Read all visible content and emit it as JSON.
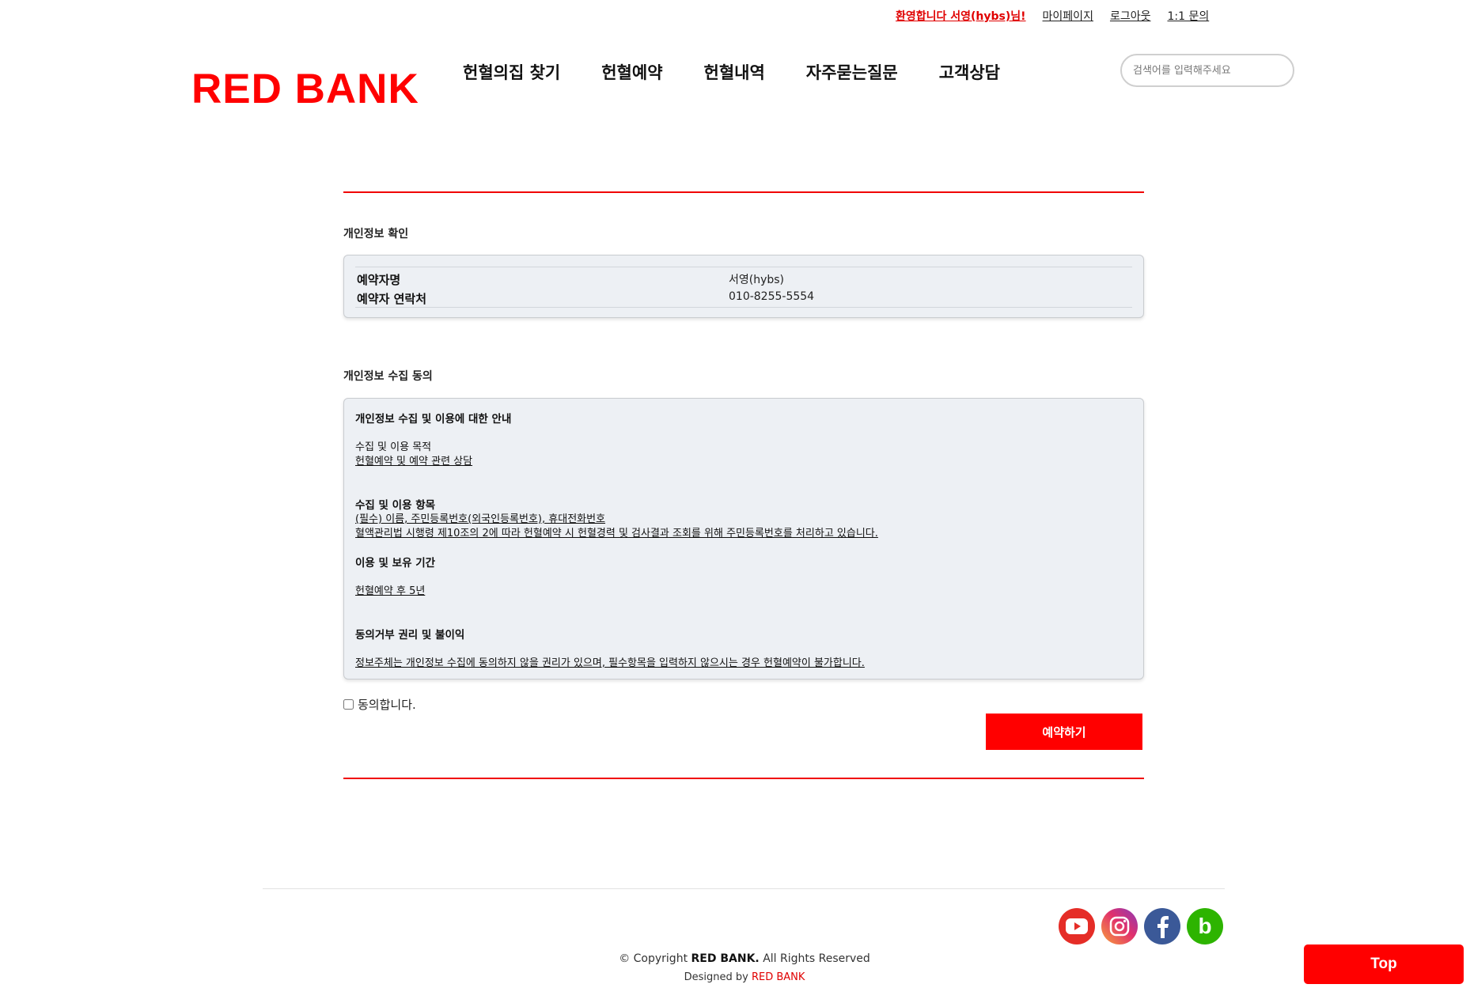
{
  "header": {
    "welcome": "환영합니다 서영(hybs)님!",
    "mypage": "마이페이지",
    "logout": "로그아웃",
    "inquiry": "1:1 문의",
    "logo": "RED BANK",
    "nav": [
      "헌혈의집 찾기",
      "헌혈예약",
      "헌혈내역",
      "자주묻는질문",
      "고객상담"
    ],
    "search_placeholder": "검색어를 입력해주세요"
  },
  "personal_info": {
    "title": "개인정보 확인",
    "name_label": "예약자명",
    "name_value": "서영(hybs)",
    "phone_label": "예약자 연락처",
    "phone_value": "010-8255-5554"
  },
  "consent": {
    "title": "개인정보 수집 동의",
    "heading": "개인정보 수집 및 이용에 대한 안내",
    "purpose_label": "수집 및 이용 목적",
    "purpose_value": "헌혈예약 및 예약 관련 상담",
    "items_label": "수집 및 이용 항목",
    "items_value_1": "(필수) 이름, 주민등록번호(외국인등록번호), 휴대전화번호",
    "items_value_2": "혈액관리법 시행령 제10조의 2에 따라 헌혈예약 시 헌혈경력 및 검사결과 조회를 위해 주민등록번호를 처리하고 있습니다.",
    "period_label": "이용 및 보유 기간",
    "period_value": "헌혈예약 후 5년",
    "refusal_label": "동의거부 권리 및 불이익",
    "refusal_value": "정보주체는 개인정보 수집에 동의하지 않을 권리가 있으며, 필수항목을 입력하지 않으시는 경우 헌혈예약이 불가합니다.",
    "agree_label": "동의합니다.",
    "agree_checked": false,
    "submit_label": "예약하기"
  },
  "footer": {
    "copyright_prefix": "© Copyright ",
    "copyright_brand": "RED BANK.",
    "copyright_suffix": " All Rights Reserved",
    "designed_prefix": "Designed by ",
    "designed_brand": "RED BANK",
    "social": [
      {
        "icon": "youtube-icon",
        "color": "#e52d27"
      },
      {
        "icon": "instagram-icon",
        "color": "#c13584"
      },
      {
        "icon": "facebook-icon",
        "color": "#3b5998"
      },
      {
        "icon": "blog-icon",
        "color": "#2db400"
      }
    ],
    "top_label": "Top"
  },
  "colors": {
    "accent": "#ff0000",
    "box_bg": "#edf0f4"
  }
}
